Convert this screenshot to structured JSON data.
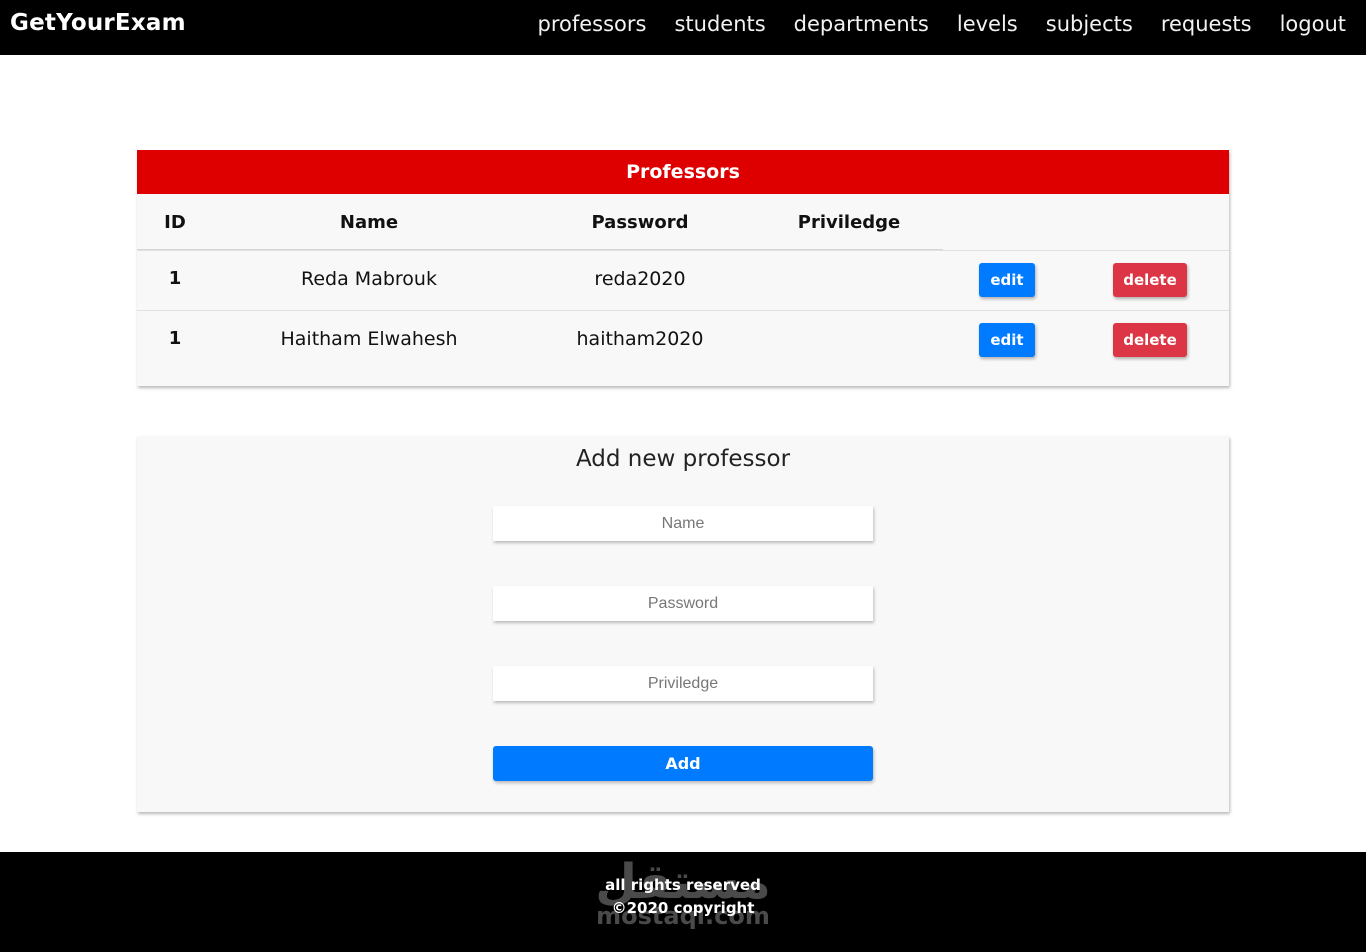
{
  "navbar": {
    "brand": "GetYourExam",
    "links": [
      "professors",
      "students",
      "departments",
      "levels",
      "subjects",
      "requests",
      "logout"
    ]
  },
  "table": {
    "title": "Professors",
    "headers": [
      "ID",
      "Name",
      "Password",
      "Priviledge"
    ],
    "rows": [
      {
        "id": "1",
        "name": "Reda Mabrouk",
        "password": "reda2020",
        "priviledge": "",
        "edit_label": "edit",
        "delete_label": "delete"
      },
      {
        "id": "1",
        "name": "Haitham Elwahesh",
        "password": "haitham2020",
        "priviledge": "",
        "edit_label": "edit",
        "delete_label": "delete"
      }
    ]
  },
  "form": {
    "title": "Add new professor",
    "name_placeholder": "Name",
    "password_placeholder": "Password",
    "priviledge_placeholder": "Priviledge",
    "name_value": "",
    "password_value": "",
    "priviledge_value": "",
    "submit_label": "Add"
  },
  "footer": {
    "line1": "all rights reserved",
    "line2": "©2020 copyright",
    "watermark_arabic": "مستقل",
    "watermark_latin": "mostaql.com"
  },
  "colors": {
    "navbar": "#000000",
    "table_title_bg": "#de0000",
    "edit_button": "#007bff",
    "delete_button": "#dc3545",
    "add_button": "#007bff"
  }
}
